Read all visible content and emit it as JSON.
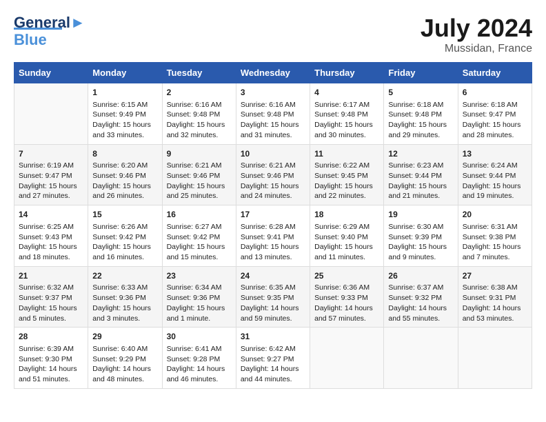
{
  "header": {
    "logo_line1": "General",
    "logo_line2": "Blue",
    "main_title": "July 2024",
    "subtitle": "Mussidan, France"
  },
  "calendar": {
    "days_of_week": [
      "Sunday",
      "Monday",
      "Tuesday",
      "Wednesday",
      "Thursday",
      "Friday",
      "Saturday"
    ],
    "weeks": [
      [
        {
          "day": "",
          "info": ""
        },
        {
          "day": "1",
          "info": "Sunrise: 6:15 AM\nSunset: 9:49 PM\nDaylight: 15 hours\nand 33 minutes."
        },
        {
          "day": "2",
          "info": "Sunrise: 6:16 AM\nSunset: 9:48 PM\nDaylight: 15 hours\nand 32 minutes."
        },
        {
          "day": "3",
          "info": "Sunrise: 6:16 AM\nSunset: 9:48 PM\nDaylight: 15 hours\nand 31 minutes."
        },
        {
          "day": "4",
          "info": "Sunrise: 6:17 AM\nSunset: 9:48 PM\nDaylight: 15 hours\nand 30 minutes."
        },
        {
          "day": "5",
          "info": "Sunrise: 6:18 AM\nSunset: 9:48 PM\nDaylight: 15 hours\nand 29 minutes."
        },
        {
          "day": "6",
          "info": "Sunrise: 6:18 AM\nSunset: 9:47 PM\nDaylight: 15 hours\nand 28 minutes."
        }
      ],
      [
        {
          "day": "7",
          "info": "Sunrise: 6:19 AM\nSunset: 9:47 PM\nDaylight: 15 hours\nand 27 minutes."
        },
        {
          "day": "8",
          "info": "Sunrise: 6:20 AM\nSunset: 9:46 PM\nDaylight: 15 hours\nand 26 minutes."
        },
        {
          "day": "9",
          "info": "Sunrise: 6:21 AM\nSunset: 9:46 PM\nDaylight: 15 hours\nand 25 minutes."
        },
        {
          "day": "10",
          "info": "Sunrise: 6:21 AM\nSunset: 9:46 PM\nDaylight: 15 hours\nand 24 minutes."
        },
        {
          "day": "11",
          "info": "Sunrise: 6:22 AM\nSunset: 9:45 PM\nDaylight: 15 hours\nand 22 minutes."
        },
        {
          "day": "12",
          "info": "Sunrise: 6:23 AM\nSunset: 9:44 PM\nDaylight: 15 hours\nand 21 minutes."
        },
        {
          "day": "13",
          "info": "Sunrise: 6:24 AM\nSunset: 9:44 PM\nDaylight: 15 hours\nand 19 minutes."
        }
      ],
      [
        {
          "day": "14",
          "info": "Sunrise: 6:25 AM\nSunset: 9:43 PM\nDaylight: 15 hours\nand 18 minutes."
        },
        {
          "day": "15",
          "info": "Sunrise: 6:26 AM\nSunset: 9:42 PM\nDaylight: 15 hours\nand 16 minutes."
        },
        {
          "day": "16",
          "info": "Sunrise: 6:27 AM\nSunset: 9:42 PM\nDaylight: 15 hours\nand 15 minutes."
        },
        {
          "day": "17",
          "info": "Sunrise: 6:28 AM\nSunset: 9:41 PM\nDaylight: 15 hours\nand 13 minutes."
        },
        {
          "day": "18",
          "info": "Sunrise: 6:29 AM\nSunset: 9:40 PM\nDaylight: 15 hours\nand 11 minutes."
        },
        {
          "day": "19",
          "info": "Sunrise: 6:30 AM\nSunset: 9:39 PM\nDaylight: 15 hours\nand 9 minutes."
        },
        {
          "day": "20",
          "info": "Sunrise: 6:31 AM\nSunset: 9:38 PM\nDaylight: 15 hours\nand 7 minutes."
        }
      ],
      [
        {
          "day": "21",
          "info": "Sunrise: 6:32 AM\nSunset: 9:37 PM\nDaylight: 15 hours\nand 5 minutes."
        },
        {
          "day": "22",
          "info": "Sunrise: 6:33 AM\nSunset: 9:36 PM\nDaylight: 15 hours\nand 3 minutes."
        },
        {
          "day": "23",
          "info": "Sunrise: 6:34 AM\nSunset: 9:36 PM\nDaylight: 15 hours\nand 1 minute."
        },
        {
          "day": "24",
          "info": "Sunrise: 6:35 AM\nSunset: 9:35 PM\nDaylight: 14 hours\nand 59 minutes."
        },
        {
          "day": "25",
          "info": "Sunrise: 6:36 AM\nSunset: 9:33 PM\nDaylight: 14 hours\nand 57 minutes."
        },
        {
          "day": "26",
          "info": "Sunrise: 6:37 AM\nSunset: 9:32 PM\nDaylight: 14 hours\nand 55 minutes."
        },
        {
          "day": "27",
          "info": "Sunrise: 6:38 AM\nSunset: 9:31 PM\nDaylight: 14 hours\nand 53 minutes."
        }
      ],
      [
        {
          "day": "28",
          "info": "Sunrise: 6:39 AM\nSunset: 9:30 PM\nDaylight: 14 hours\nand 51 minutes."
        },
        {
          "day": "29",
          "info": "Sunrise: 6:40 AM\nSunset: 9:29 PM\nDaylight: 14 hours\nand 48 minutes."
        },
        {
          "day": "30",
          "info": "Sunrise: 6:41 AM\nSunset: 9:28 PM\nDaylight: 14 hours\nand 46 minutes."
        },
        {
          "day": "31",
          "info": "Sunrise: 6:42 AM\nSunset: 9:27 PM\nDaylight: 14 hours\nand 44 minutes."
        },
        {
          "day": "",
          "info": ""
        },
        {
          "day": "",
          "info": ""
        },
        {
          "day": "",
          "info": ""
        }
      ]
    ]
  }
}
